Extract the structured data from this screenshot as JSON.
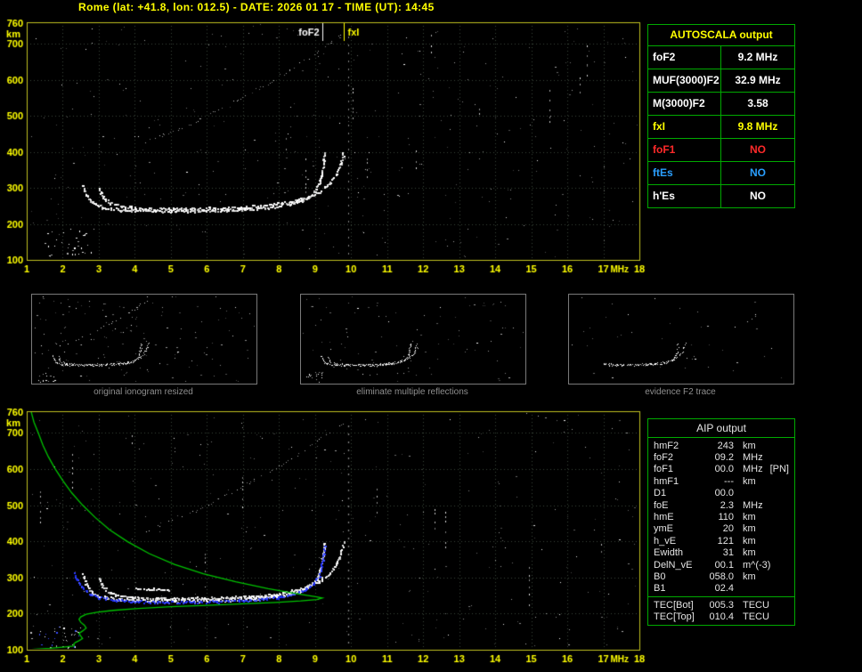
{
  "title": "Rome (lat: +41.8, lon: 012.5) - DATE: 2026 01 17 - TIME (UT): 14:45",
  "autoscala": {
    "title": "AUTOSCALA output",
    "rows": [
      {
        "label": "foF2",
        "value": "9.2 MHz",
        "color": "#ffffff"
      },
      {
        "label": "MUF(3000)F2",
        "value": "32.9 MHz",
        "color": "#ffffff"
      },
      {
        "label": "M(3000)F2",
        "value": "3.58",
        "color": "#ffffff"
      },
      {
        "label": "fxI",
        "value": "9.8 MHz",
        "color": "#ffff00"
      },
      {
        "label": "foF1",
        "value": "NO",
        "color": "#ff2a2a"
      },
      {
        "label": "ftEs",
        "value": "NO",
        "color": "#2a9fff"
      },
      {
        "label": "h'Es",
        "value": "NO",
        "color": "#ffffff"
      }
    ]
  },
  "thumbnails": {
    "captions": [
      "original ionogram resized",
      "eliminate multiple reflections",
      "evidence F2 trace"
    ]
  },
  "aip": {
    "title": "AIP output",
    "rows": [
      {
        "label": "hmF2",
        "value": "243",
        "unit": "km"
      },
      {
        "label": "foF2",
        "value": "09.2",
        "unit": "MHz"
      },
      {
        "label": "foF1",
        "value": "00.0",
        "unit": "MHz",
        "suffix": "[PN]"
      },
      {
        "label": "hmF1",
        "value": "---",
        "unit": "km"
      },
      {
        "label": "D1",
        "value": "00.0",
        "unit": ""
      },
      {
        "label": "foE",
        "value": "2.3",
        "unit": "MHz"
      },
      {
        "label": "hmE",
        "value": "110",
        "unit": "km"
      },
      {
        "label": "ymE",
        "value": "20",
        "unit": "km"
      },
      {
        "label": "h_vE",
        "value": "121",
        "unit": "km"
      },
      {
        "label": "Ewidth",
        "value": "31",
        "unit": "km"
      },
      {
        "label": "DelN_vE",
        "value": "00.1",
        "unit": "m^(-3)"
      },
      {
        "label": "B0",
        "value": "058.0",
        "unit": "km"
      },
      {
        "label": "B1",
        "value": "02.4",
        "unit": ""
      }
    ],
    "tec_rows": [
      {
        "label": "TEC[Bot]",
        "value": "005.3",
        "unit": "TECU"
      },
      {
        "label": "TEC[Top]",
        "value": "010.4",
        "unit": "TECU"
      }
    ]
  },
  "chart_data": [
    {
      "id": "top-ionogram",
      "type": "scatter",
      "title": "ionogram with autoscaled characteristics",
      "xlabel": "MHz",
      "ylabel": "km",
      "xlim": [
        1,
        18
      ],
      "ylim": [
        100,
        760
      ],
      "xticks": [
        1,
        2,
        3,
        4,
        5,
        6,
        7,
        8,
        9,
        10,
        11,
        12,
        13,
        14,
        15,
        16,
        17,
        18
      ],
      "yticks": [
        100,
        200,
        300,
        400,
        500,
        600,
        700
      ],
      "grid": true,
      "markers": [
        {
          "label": "foF2",
          "freq": 9.2,
          "color": "#ffffff",
          "side": "left"
        },
        {
          "label": "fxI",
          "freq": 9.8,
          "color": "#ffff00",
          "side": "right"
        }
      ],
      "rfi_freq": 9.93,
      "clusters": [
        {
          "f0": 1.4,
          "f1": 2.8,
          "h0": 108,
          "h1": 185,
          "n": 30,
          "blue": false
        }
      ],
      "traces": {
        "o_trace": [
          [
            2.55,
            308
          ],
          [
            2.65,
            282
          ],
          [
            2.78,
            262
          ],
          [
            2.95,
            251
          ],
          [
            3.2,
            245
          ],
          [
            3.6,
            240
          ],
          [
            4.2,
            238
          ],
          [
            5.0,
            237
          ],
          [
            5.8,
            237
          ],
          [
            6.6,
            239
          ],
          [
            7.2,
            242
          ],
          [
            7.8,
            247
          ],
          [
            8.2,
            254
          ],
          [
            8.55,
            263
          ],
          [
            8.8,
            275
          ],
          [
            9.0,
            292
          ],
          [
            9.1,
            312
          ],
          [
            9.17,
            338
          ],
          [
            9.22,
            368
          ],
          [
            9.25,
            398
          ]
        ],
        "x_trace": [
          [
            3.0,
            301
          ],
          [
            3.1,
            276
          ],
          [
            3.3,
            259
          ],
          [
            3.6,
            250
          ],
          [
            4.0,
            246
          ],
          [
            4.6,
            243
          ],
          [
            5.4,
            243
          ],
          [
            6.2,
            244
          ],
          [
            7.0,
            247
          ],
          [
            7.6,
            252
          ],
          [
            8.1,
            259
          ],
          [
            8.5,
            267
          ],
          [
            8.85,
            278
          ],
          [
            9.15,
            293
          ],
          [
            9.4,
            313
          ],
          [
            9.58,
            339
          ],
          [
            9.7,
            369
          ],
          [
            9.78,
            400
          ]
        ],
        "oblique": [
          [
            4.3,
            428
          ],
          [
            4.8,
            448
          ],
          [
            5.3,
            468
          ],
          [
            5.8,
            492
          ],
          [
            6.3,
            516
          ],
          [
            6.8,
            542
          ],
          [
            7.3,
            570
          ],
          [
            7.8,
            598
          ],
          [
            8.3,
            628
          ],
          [
            8.7,
            654
          ],
          [
            9.1,
            682
          ],
          [
            9.45,
            706
          ],
          [
            9.78,
            728
          ]
        ]
      }
    },
    {
      "id": "bottom-ionogram",
      "type": "scatter",
      "title": "ionogram with restored trace and electron density profile",
      "xlabel": "MHz",
      "ylabel": "km",
      "xlim": [
        1,
        18
      ],
      "ylim": [
        100,
        760
      ],
      "xticks": [
        1,
        2,
        3,
        4,
        5,
        6,
        7,
        8,
        9,
        10,
        11,
        12,
        13,
        14,
        15,
        16,
        17,
        18
      ],
      "yticks": [
        100,
        200,
        300,
        400,
        500,
        600,
        700
      ],
      "grid": true,
      "rfi_freq": 9.93,
      "clusters": [
        {
          "f0": 1.0,
          "f1": 2.5,
          "h0": 100,
          "h1": 168,
          "n": 40,
          "blue": true
        }
      ],
      "extra_segments": [
        [
          [
            4.0,
            272
          ],
          [
            4.5,
            269
          ],
          [
            4.95,
            267
          ]
        ]
      ],
      "blue_trace": [
        [
          2.3,
          314
        ],
        [
          2.4,
          293
        ],
        [
          2.55,
          272
        ],
        [
          2.75,
          256
        ],
        [
          3.0,
          246
        ],
        [
          3.4,
          239
        ],
        [
          3.9,
          235
        ],
        [
          4.6,
          233
        ],
        [
          5.4,
          233
        ],
        [
          6.2,
          234
        ],
        [
          6.9,
          237
        ],
        [
          7.5,
          241
        ],
        [
          8.0,
          247
        ],
        [
          8.4,
          255
        ],
        [
          8.7,
          267
        ],
        [
          8.95,
          284
        ],
        [
          9.1,
          306
        ],
        [
          9.18,
          333
        ],
        [
          9.23,
          363
        ],
        [
          9.26,
          390
        ]
      ],
      "profile": [
        [
          1.12,
          760
        ],
        [
          1.2,
          730
        ],
        [
          1.32,
          700
        ],
        [
          1.45,
          666
        ],
        [
          1.6,
          634
        ],
        [
          1.78,
          602
        ],
        [
          2.0,
          568
        ],
        [
          2.25,
          534
        ],
        [
          2.55,
          500
        ],
        [
          2.9,
          466
        ],
        [
          3.3,
          432
        ],
        [
          3.8,
          399
        ],
        [
          4.4,
          366
        ],
        [
          5.1,
          336
        ],
        [
          5.9,
          310
        ],
        [
          6.8,
          288
        ],
        [
          7.7,
          269
        ],
        [
          8.5,
          255
        ],
        [
          9.05,
          246
        ],
        [
          9.2,
          243
        ],
        [
          9.05,
          239
        ],
        [
          8.6,
          235
        ],
        [
          7.9,
          231
        ],
        [
          7.0,
          227
        ],
        [
          6.0,
          223
        ],
        [
          5.0,
          219
        ],
        [
          4.1,
          214
        ],
        [
          3.4,
          209
        ],
        [
          2.95,
          204
        ],
        [
          2.65,
          198
        ],
        [
          2.5,
          191
        ],
        [
          2.45,
          184
        ],
        [
          2.5,
          176
        ],
        [
          2.6,
          168
        ],
        [
          2.65,
          160
        ],
        [
          2.55,
          152
        ],
        [
          2.45,
          145
        ],
        [
          2.5,
          138
        ],
        [
          2.55,
          131
        ],
        [
          2.45,
          125
        ],
        [
          2.35,
          120
        ],
        [
          2.3,
          115
        ],
        [
          2.32,
          112
        ],
        [
          2.3,
          110
        ],
        [
          2.0,
          107
        ],
        [
          1.65,
          104
        ],
        [
          1.3,
          102
        ],
        [
          1.0,
          100
        ]
      ]
    }
  ]
}
